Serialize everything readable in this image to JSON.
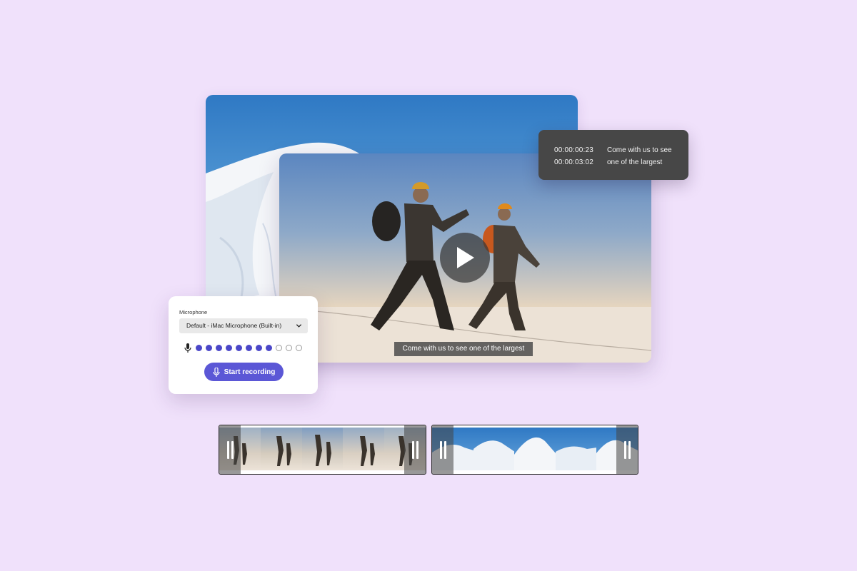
{
  "caption": {
    "start_time": "00:00:00:23",
    "end_time": "00:00:03:02",
    "text_line1": "Come with us to see",
    "text_line2": "one of the largest"
  },
  "video": {
    "subtitle": "Come with us to see one of the largest",
    "play_icon": "play-icon"
  },
  "microphone": {
    "label": "Microphone",
    "selected_device": "Default - iMac Microphone (Built-in)",
    "level_active": 8,
    "level_total": 11,
    "record_label": "Start recording"
  },
  "colors": {
    "background": "#f0e1fb",
    "accent": "#5b57d6",
    "meter_on": "#4b47c8",
    "caption_card": "#474747"
  }
}
